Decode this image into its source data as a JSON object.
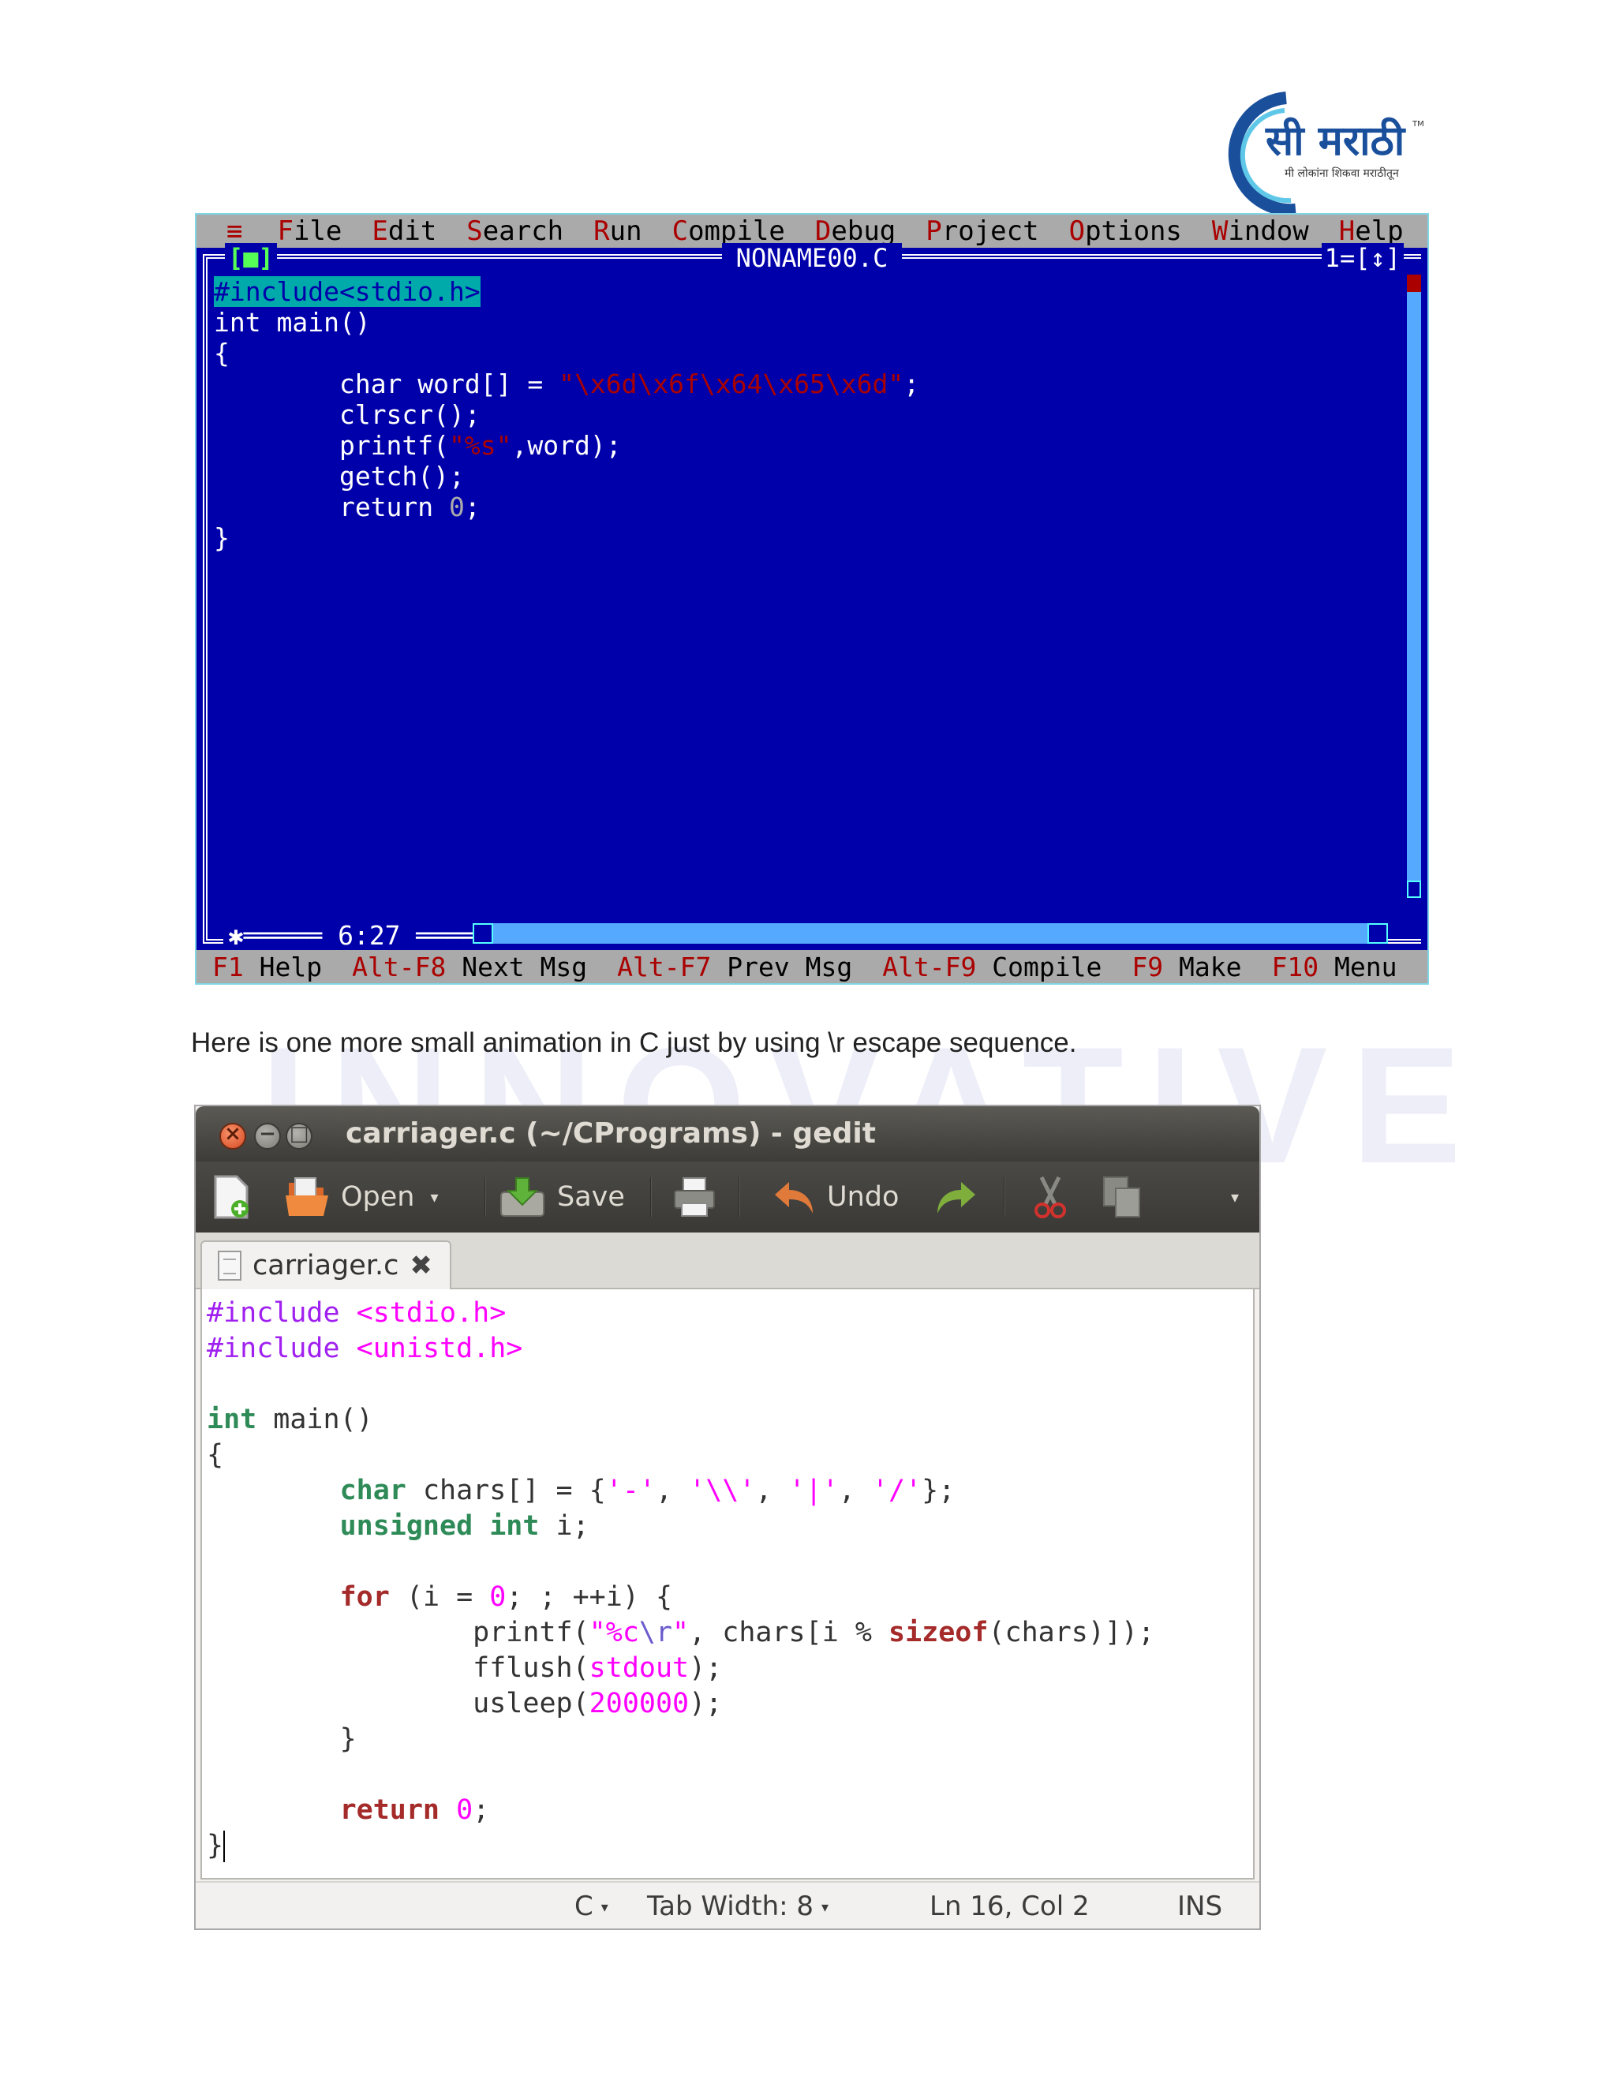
{
  "logo": {
    "text": "सी मराठी",
    "tagline": "मी लोकांना शिकवा मराठीतून",
    "tm": "TM"
  },
  "watermark": {
    "text": "INNOVATIVE"
  },
  "turbo_c": {
    "menu": {
      "system": "≡",
      "items": [
        {
          "hotkey": "F",
          "rest": "ile"
        },
        {
          "hotkey": "E",
          "rest": "dit"
        },
        {
          "hotkey": "S",
          "rest": "earch"
        },
        {
          "hotkey": "R",
          "rest": "un"
        },
        {
          "hotkey": "C",
          "rest": "ompile"
        },
        {
          "hotkey": "D",
          "rest": "ebug"
        },
        {
          "hotkey": "P",
          "rest": "roject"
        },
        {
          "hotkey": "O",
          "rest": "ptions"
        },
        {
          "hotkey": "W",
          "rest": "indow"
        },
        {
          "hotkey": "H",
          "rest": "elp"
        }
      ]
    },
    "window": {
      "close": "[■]",
      "title": "NONAME00.C",
      "number": "1",
      "zoom": "[↕]"
    },
    "code": {
      "line1": "#include<stdio.h>",
      "line2": "int main()",
      "line3": "{",
      "line4_a": "char word[] = ",
      "line4_str": "\"\\x6d\\x6f\\x64\\x65\\x6d\"",
      "line4_b": ";",
      "line5": "clrscr();",
      "line6_a": "printf(",
      "line6_str": "\"%s\"",
      "line6_b": ",word);",
      "line7": "getch();",
      "line8_a": "return ",
      "line8_num": "0",
      "line8_b": ";",
      "line9": "}"
    },
    "position": "6:27",
    "help": [
      {
        "key": "F1",
        "label": "Help"
      },
      {
        "key": "Alt-F8",
        "label": "Next Msg"
      },
      {
        "key": "Alt-F7",
        "label": "Prev Msg"
      },
      {
        "key": "Alt-F9",
        "label": "Compile"
      },
      {
        "key": "F9",
        "label": "Make"
      },
      {
        "key": "F10",
        "label": "Menu"
      }
    ]
  },
  "caption": "Here is one more small animation in C just by using \\r escape sequence.",
  "gedit": {
    "title": "carriager.c (~/CPrograms) - gedit",
    "window_buttons": {
      "close": "×",
      "minimize": "−",
      "maximize": "□"
    },
    "toolbar": {
      "open": "Open",
      "save": "Save",
      "undo": "Undo",
      "more": "▾",
      "open_menu": "▾"
    },
    "tab": {
      "name": "carriager.c",
      "close": "✖"
    },
    "code": {
      "inc1_kw": "#include ",
      "inc1_file": "<stdio.h>",
      "inc2_kw": "#include ",
      "inc2_file": "<unistd.h>",
      "main_type": "int",
      "main_rest": " main()",
      "open_brace": "{",
      "l1_type": "char",
      "l1_a": " chars[] = {",
      "l1_s1": "'-'",
      "l1_c1": ", ",
      "l1_s2": "'\\\\'",
      "l1_c2": ", ",
      "l1_s3": "'|'",
      "l1_c3": ", ",
      "l1_s4": "'/'",
      "l1_end": "};",
      "l2_type1": "unsigned",
      "l2_sp": " ",
      "l2_type2": "int",
      "l2_rest": " i;",
      "l3_kw": "for",
      "l3_a": " (i = ",
      "l3_num": "0",
      "l3_b": "; ; ++i) {",
      "l4_a": "printf(",
      "l4_s1": "\"%c",
      "l4_esc": "\\r",
      "l4_s2": "\"",
      "l4_b": ", chars[i % ",
      "l4_kw": "sizeof",
      "l4_c": "(chars)]);",
      "l5_a": "fflush(",
      "l5_var": "stdout",
      "l5_b": ");",
      "l6_a": "usleep(",
      "l6_num": "200000",
      "l6_b": ");",
      "l7": "}",
      "l8_kw": "return",
      "l8_sp": " ",
      "l8_num": "0",
      "l8_end": ";",
      "close_brace": "}"
    },
    "status": {
      "language": "C",
      "tab_width": "Tab Width:  8",
      "position": "Ln 16, Col 2",
      "mode": "INS",
      "dropdown": "▾"
    }
  }
}
